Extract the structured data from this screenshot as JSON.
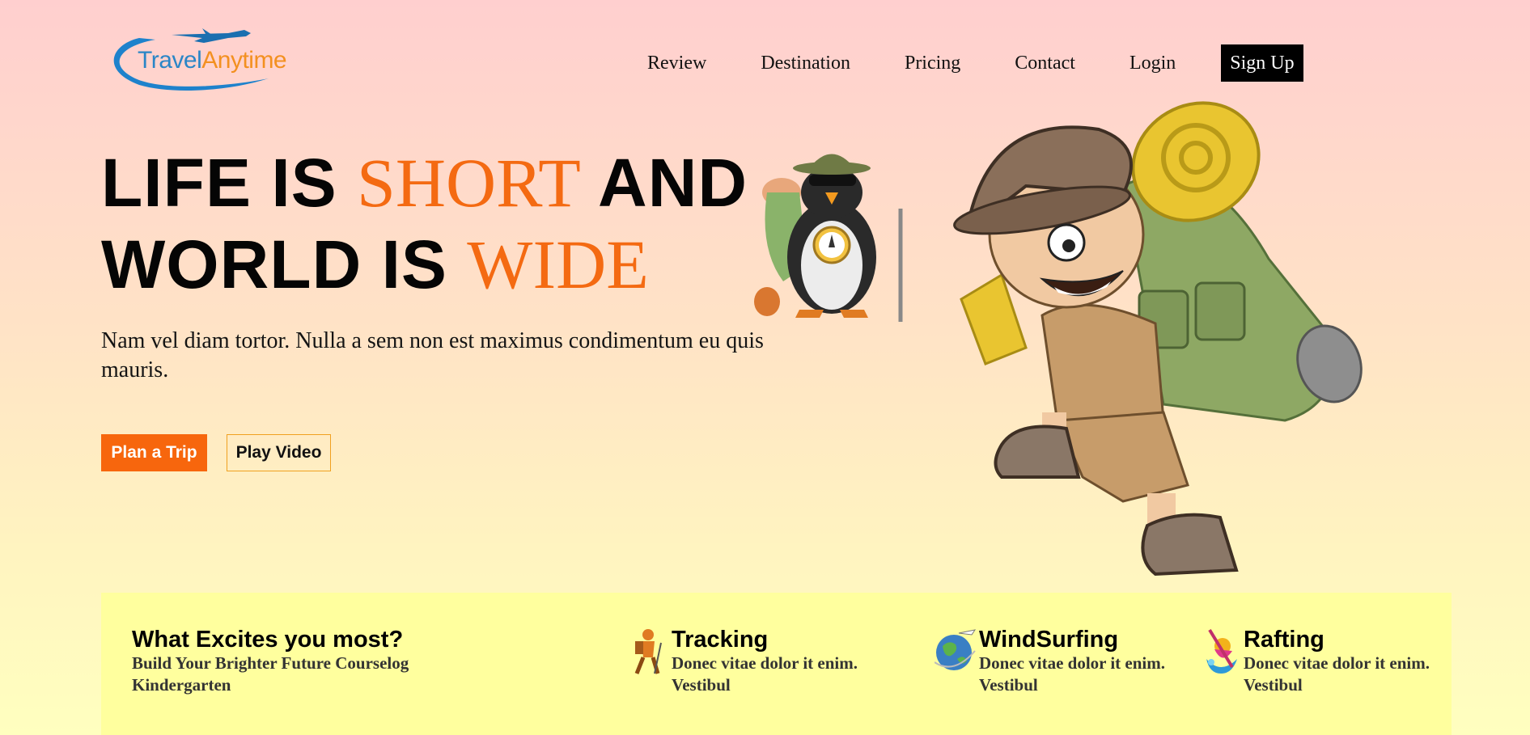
{
  "brand": {
    "name_part1": "Travel",
    "name_part2": "Anytime"
  },
  "nav": {
    "items": [
      "Review",
      "Destination",
      "Pricing",
      "Contact",
      "Login"
    ],
    "signup_label": "Sign Up"
  },
  "hero": {
    "line1_a": "LIFE IS ",
    "line1_accent": "SHORT",
    "line1_b": " AND",
    "line2_a": "WORLD IS ",
    "line2_accent": "WIDE",
    "subtitle": "Nam vel diam tortor. Nulla a sem non est maximus condimentum eu quis mauris.",
    "primary_button": "Plan a Trip",
    "secondary_button": "Play Video"
  },
  "excites": {
    "title": "What Excites you most?",
    "description": "Build Your Brighter Future Courselog Kindergarten",
    "items": [
      {
        "title": "Tracking",
        "desc_line1": "Donec vitae dolor it enim.",
        "desc_line2": "Vestibul",
        "icon": "hiker-icon"
      },
      {
        "title": "WindSurfing",
        "desc_line1": "Donec vitae dolor it enim.",
        "desc_line2": "Vestibul",
        "icon": "globe-plane-icon"
      },
      {
        "title": "Rafting",
        "desc_line1": "Donec vitae dolor it enim.",
        "desc_line2": "Vestibul",
        "icon": "rafting-icon"
      }
    ]
  },
  "colors": {
    "accent": "#f46a12",
    "button_primary": "#f7660d",
    "brand_blue": "#2a86c7",
    "brand_orange": "#f39020",
    "section_bg": "#ffff9e"
  }
}
